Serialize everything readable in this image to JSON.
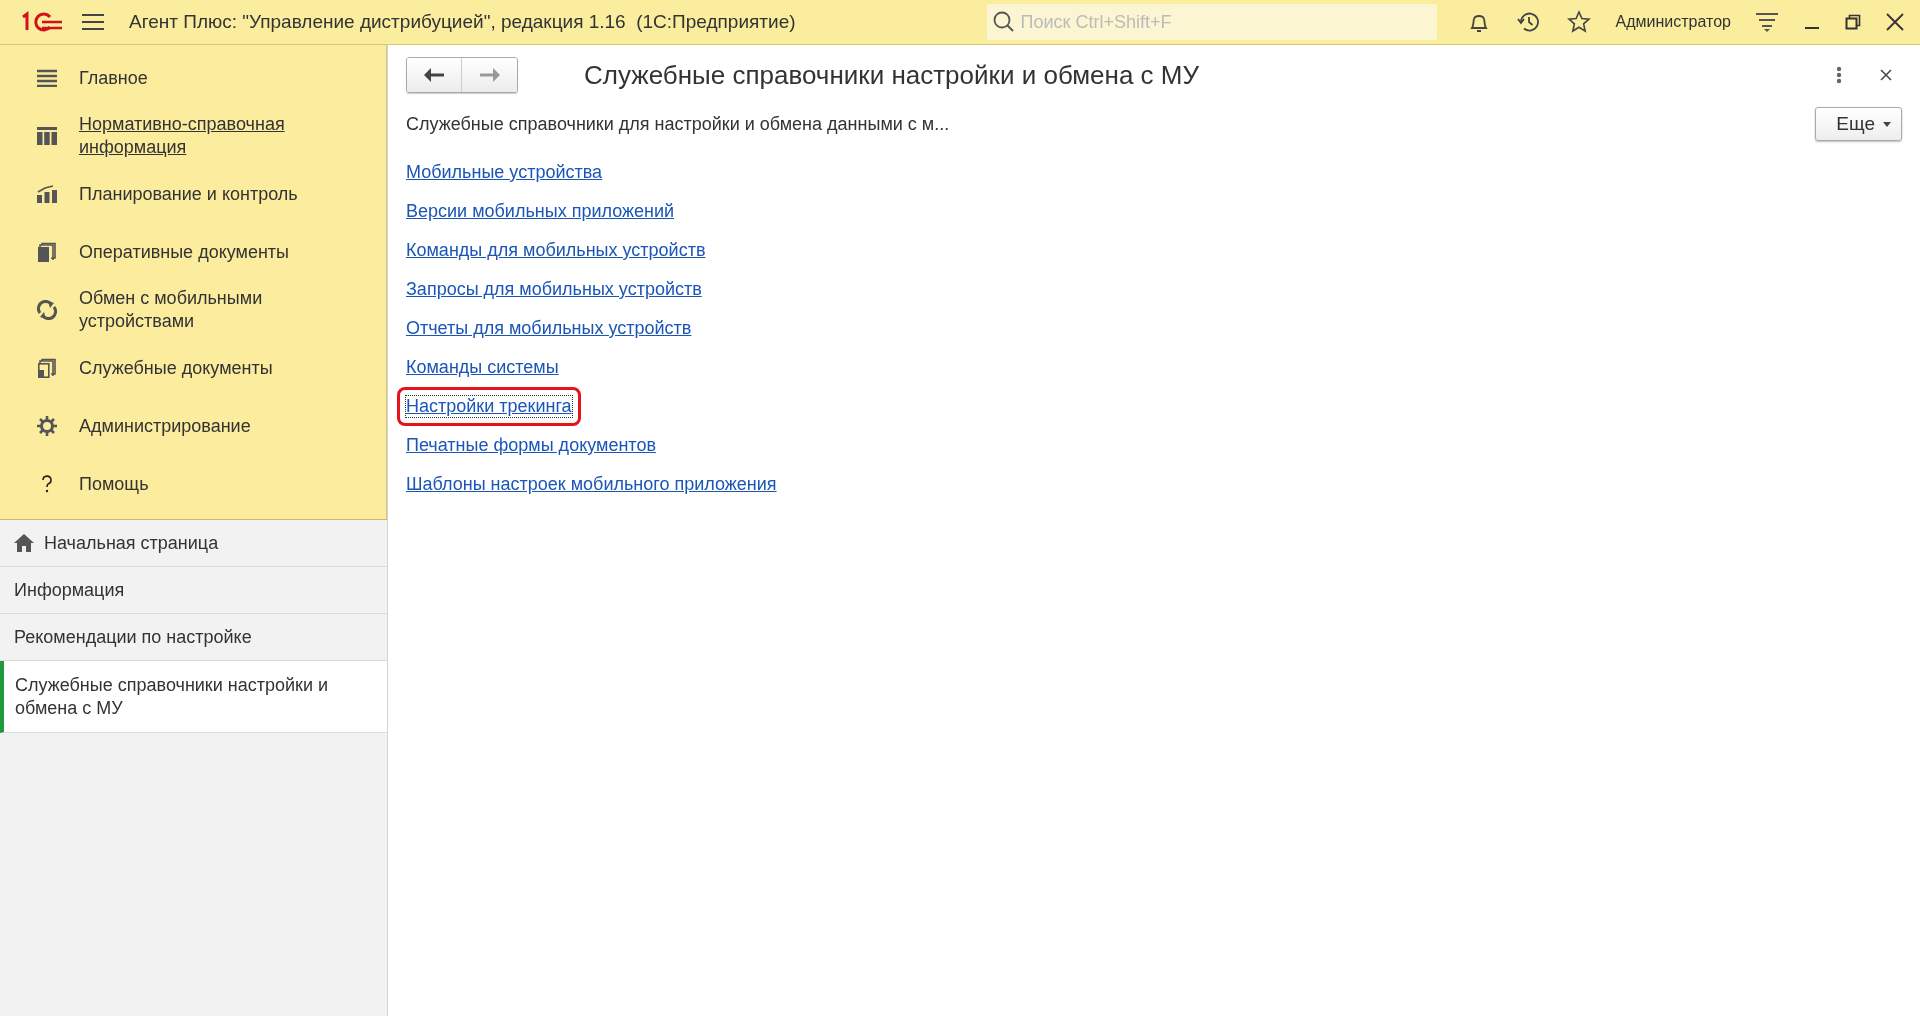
{
  "window": {
    "title": "Агент Плюс: \"Управление дистрибуцией\", редакция 1.16  (1С:Предприятие)",
    "search": {
      "placeholder": "Поиск Ctrl+Shift+F"
    },
    "user": "Администратор"
  },
  "sections": [
    {
      "label": "Главное",
      "kind": "lines",
      "hovered": false
    },
    {
      "label": "Нормативно-справочная информация",
      "kind": "books",
      "hovered": true
    },
    {
      "label": "Планирование и контроль",
      "kind": "chart",
      "hovered": false
    },
    {
      "label": "Оперативные документы",
      "kind": "docs",
      "hovered": false
    },
    {
      "label": "Обмен с мобильными устройствами",
      "kind": "sync",
      "hovered": false
    },
    {
      "label": "Служебные документы",
      "kind": "servdocs",
      "hovered": false
    },
    {
      "label": "Администрирование",
      "kind": "gear",
      "hovered": false
    },
    {
      "label": "Помощь",
      "kind": "help",
      "hovered": false
    }
  ],
  "open_pages": [
    {
      "label": "Начальная страница",
      "kind": "home",
      "selected": false
    },
    {
      "label": "Информация",
      "kind": "page",
      "selected": false
    },
    {
      "label": "Рекомендации по настройке",
      "kind": "page",
      "selected": false
    },
    {
      "label": "Служебные справочники настройки и обмена с МУ",
      "kind": "page",
      "selected": true
    }
  ],
  "form": {
    "title": "Служебные справочники настройки и обмена с МУ",
    "description": "Служебные справочники для настройки и обмена данными с м...",
    "more_button": "Еще",
    "links": [
      {
        "label": "Мобильные устройства",
        "highlighted": false
      },
      {
        "label": "Версии мобильных приложений",
        "highlighted": false
      },
      {
        "label": "Команды для мобильных устройств",
        "highlighted": false
      },
      {
        "label": "Запросы для мобильных устройств",
        "highlighted": false
      },
      {
        "label": "Отчеты для мобильных устройств",
        "highlighted": false
      },
      {
        "label": "Команды системы",
        "highlighted": false
      },
      {
        "label": "Настройки трекинга",
        "highlighted": true
      },
      {
        "label": "Печатные формы документов",
        "highlighted": false
      },
      {
        "label": "Шаблоны настроек мобильного приложения",
        "highlighted": false
      }
    ]
  }
}
